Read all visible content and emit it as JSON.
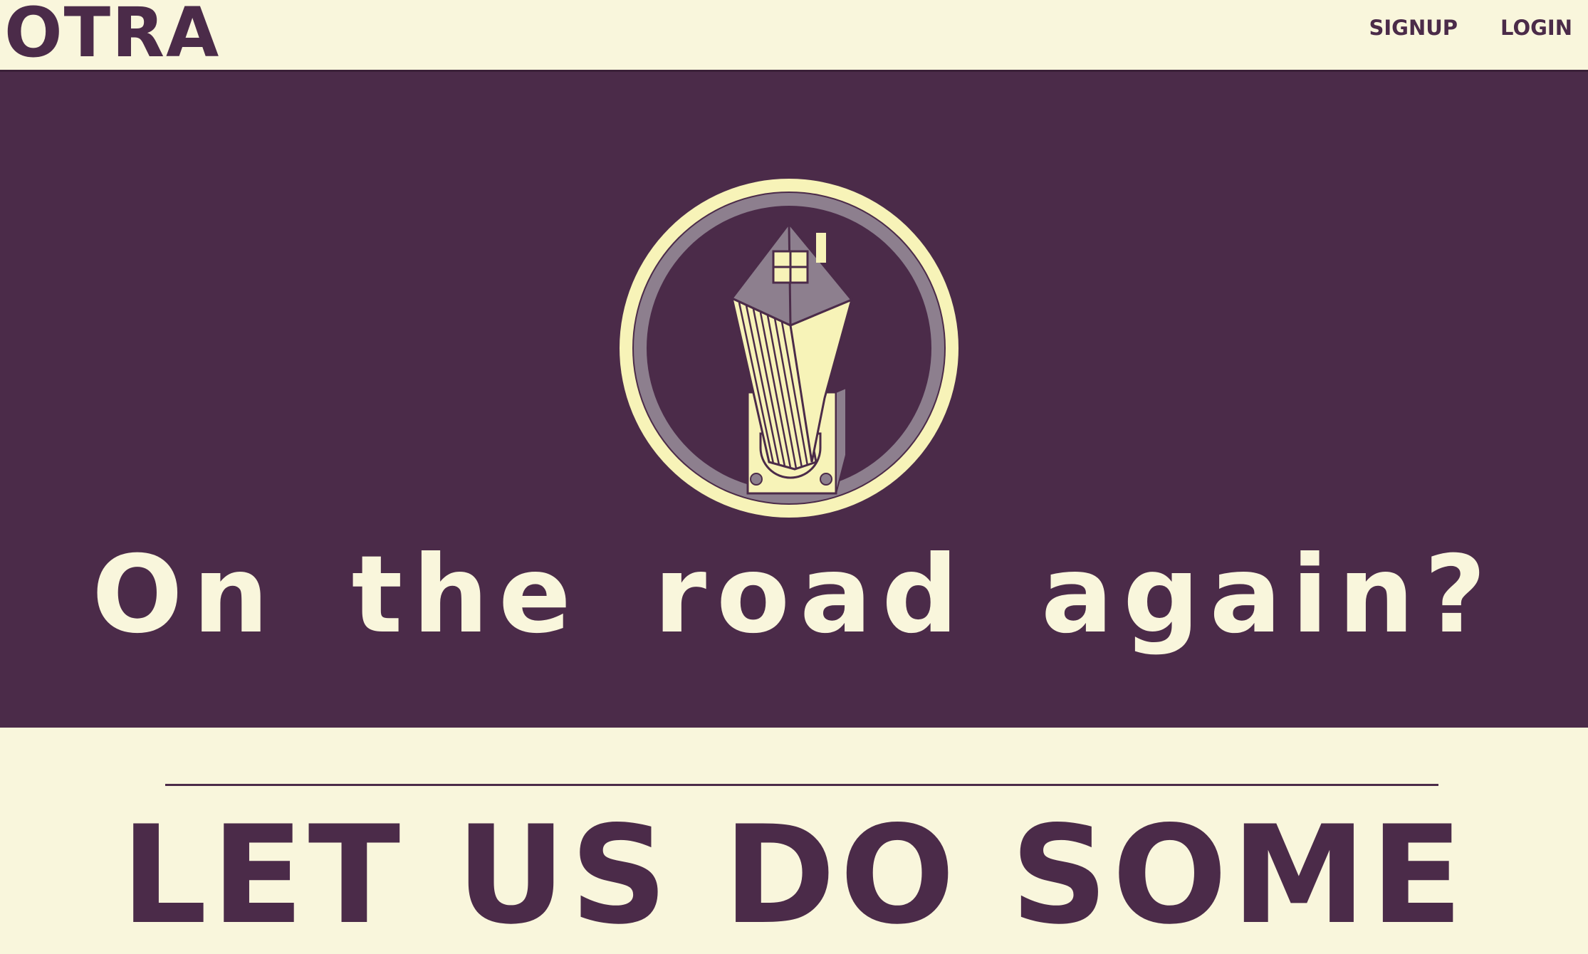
{
  "header": {
    "logo_text": "OTRA",
    "nav": [
      {
        "label": "SIGNUP"
      },
      {
        "label": "LOGIN"
      }
    ]
  },
  "hero": {
    "emblem_icon": "house-on-trailer-icon",
    "tagline": "On the road again?"
  },
  "section": {
    "heading": "LET US DO SOME"
  },
  "colors": {
    "primary": "#4b2b49",
    "cream": "#f9f6dc",
    "yellow": "#f7f3b8",
    "mauve": "#8d7f8e"
  }
}
